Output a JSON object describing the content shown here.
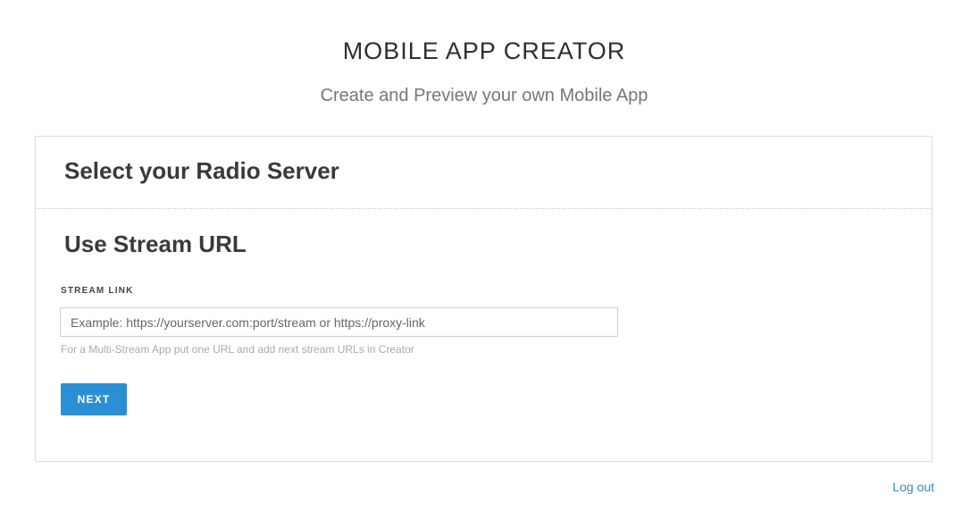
{
  "header": {
    "title": "MOBILE APP CREATOR",
    "subtitle": "Create and Preview your own Mobile App"
  },
  "card": {
    "title": "Select your Radio Server",
    "section_title": "Use Stream URL",
    "stream_field": {
      "label": "STREAM LINK",
      "value": "",
      "placeholder": "Example: https://yourserver.com:port/stream or https://proxy-link",
      "help": "For a Multi-Stream App put one URL and add next stream URLs in Creator"
    },
    "next_label": "NEXT"
  },
  "footer": {
    "logout_label": "Log out"
  },
  "colors": {
    "accent": "#2b8fd4",
    "link": "#3a87c8"
  }
}
